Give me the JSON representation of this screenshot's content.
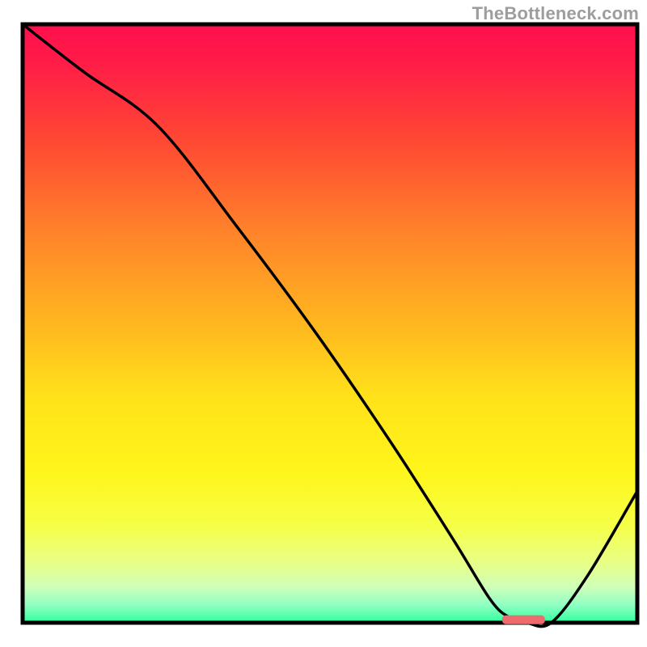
{
  "attribution": "TheBottleneck.com",
  "colors": {
    "black": "#000000",
    "gradient_stops": [
      {
        "offset": 0.0,
        "color": "#ff0f4d"
      },
      {
        "offset": 0.06,
        "color": "#ff1b48"
      },
      {
        "offset": 0.2,
        "color": "#ff4a33"
      },
      {
        "offset": 0.35,
        "color": "#ff842a"
      },
      {
        "offset": 0.5,
        "color": "#ffb61f"
      },
      {
        "offset": 0.62,
        "color": "#ffe11a"
      },
      {
        "offset": 0.75,
        "color": "#fff61b"
      },
      {
        "offset": 0.84,
        "color": "#f5ff49"
      },
      {
        "offset": 0.9,
        "color": "#e8ff87"
      },
      {
        "offset": 0.94,
        "color": "#cfffb8"
      },
      {
        "offset": 0.97,
        "color": "#91ffc3"
      },
      {
        "offset": 1.0,
        "color": "#2fff9d"
      }
    ],
    "marker": "#ed6a6f",
    "grey": "#9d9d9d"
  },
  "chart_data": {
    "type": "line",
    "title": "",
    "xlabel": "",
    "ylabel": "",
    "xlim": [
      0,
      100
    ],
    "ylim": [
      0,
      100
    ],
    "x": [
      0,
      10,
      22,
      35,
      48,
      60,
      70,
      76,
      79,
      82,
      86,
      92,
      100
    ],
    "values": [
      100,
      92,
      83,
      66,
      48,
      30,
      14,
      4,
      1,
      0,
      0,
      8,
      22
    ],
    "marker_segment": {
      "x0": 78,
      "x1": 85,
      "y": 0.5
    }
  }
}
